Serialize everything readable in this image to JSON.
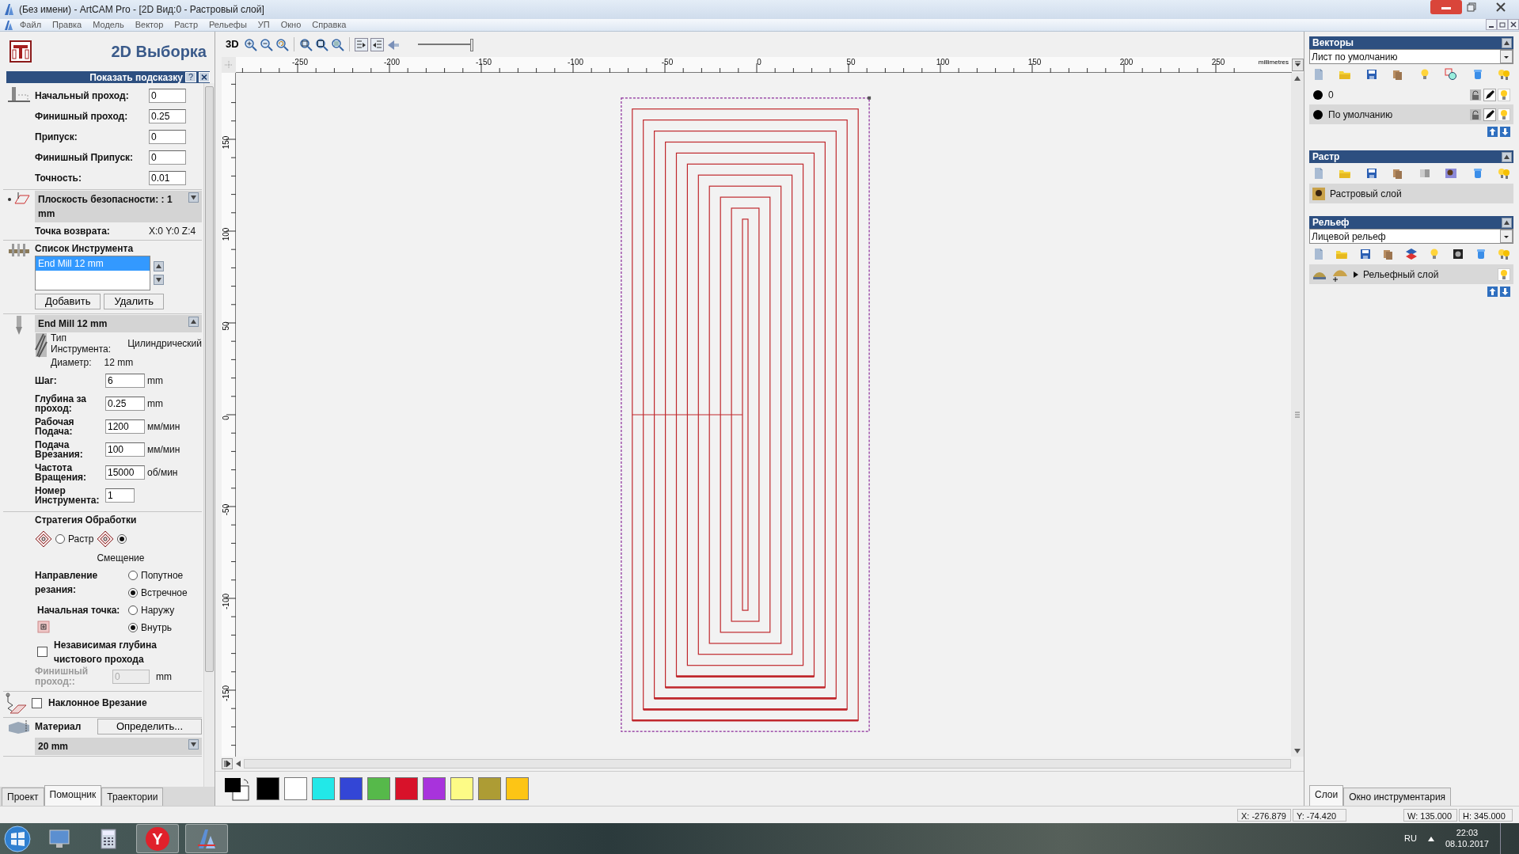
{
  "window": {
    "title": "(Без имени) - ArtCAM Pro - [2D Вид:0 - Растровый слой]"
  },
  "menu": [
    "Файл",
    "Правка",
    "Модель",
    "Вектор",
    "Растр",
    "Рельефы",
    "УП",
    "Окно",
    "Справка"
  ],
  "left_panel": {
    "title": "2D Выборка",
    "hint": "Показать подсказку",
    "help": "?",
    "params": [
      {
        "label": "Начальный проход:",
        "value": "0"
      },
      {
        "label": "Финишный проход:",
        "value": "0.25"
      },
      {
        "label": "Припуск:",
        "value": "0"
      },
      {
        "label": "Финишный Припуск:",
        "value": "0"
      },
      {
        "label": "Точность:",
        "value": "0.01"
      }
    ],
    "safe_z": {
      "label": "Плоскость безопасности: : 1 mm",
      "expanded": false
    },
    "home": {
      "label": "Точка возврата:",
      "value": "X:0 Y:0 Z:4"
    },
    "tool_list": {
      "label": "Список Инструмента",
      "items": [
        {
          "name": "End Mill 12 mm",
          "selected": true
        }
      ],
      "buttons": [
        "Добавить",
        "Удалить"
      ]
    },
    "tool": {
      "name": "End Mill 12 mm",
      "expanded": true,
      "type_label": "Тип Инструмента:",
      "type_value": "Цилиндрический",
      "diameter_label": "Диаметр:",
      "diameter_value": "12 mm"
    },
    "tool_params": [
      {
        "label": "Шаг:",
        "value": "6",
        "unit": "mm"
      },
      {
        "label": "Глубина за проход:",
        "value": "0.25",
        "unit": "mm"
      },
      {
        "label": "Рабочая Подача:",
        "value": "1200",
        "unit": "мм/мин"
      },
      {
        "label": "Подача Врезания:",
        "value": "100",
        "unit": "мм/мин"
      },
      {
        "label": "Частота Вращения:",
        "value": "15000",
        "unit": "об/мин"
      },
      {
        "label": "Номер Инструмента:",
        "value": "1"
      }
    ],
    "strategy": {
      "label": "Стратегия Обработки",
      "options": [
        {
          "label": "Растр",
          "selected": false
        },
        {
          "label": "Смещение",
          "selected": true
        }
      ]
    },
    "direction": {
      "label": "Направление резания:",
      "options": [
        {
          "label": "Попутное",
          "selected": false
        },
        {
          "label": "Встречное",
          "selected": true
        }
      ]
    },
    "start_point": {
      "label": "Начальная точка:",
      "options": [
        {
          "label": "Наружу",
          "selected": false
        },
        {
          "label": "Внутрь",
          "selected": true
        }
      ]
    },
    "independent_depth": {
      "label": "Независимая глубина чистового прохода",
      "checked": false
    },
    "finish_pass": {
      "label": "Финишный проход::",
      "value": "0",
      "unit": "mm",
      "disabled": true
    },
    "ramp": {
      "label": "Наклонное Врезание",
      "checked": false
    },
    "material": {
      "label": "Материал",
      "button": "Определить...",
      "value": "20 mm",
      "expanded": false
    },
    "tabs": [
      {
        "label": "Проект",
        "selected": false
      },
      {
        "label": "Помощник",
        "selected": true
      },
      {
        "label": "Траектории",
        "selected": false
      }
    ]
  },
  "toolbar": {
    "view_3d": "3D",
    "slider": {
      "level": 1
    }
  },
  "ruler": {
    "unit": "millimetres",
    "x_labels": [
      "-250",
      "-200",
      "-150",
      "-100",
      "-50",
      "0",
      "50",
      "100",
      "150",
      "200",
      "250"
    ],
    "y_labels": [
      "150",
      "100",
      "50",
      "0",
      "-50",
      "-100",
      "-150"
    ]
  },
  "palette": {
    "colors": [
      {
        "color": "#000000"
      },
      {
        "color": "#ffffff"
      },
      {
        "color": "#22e8e8"
      },
      {
        "color": "#3346d6"
      },
      {
        "color": "#56b94a"
      },
      {
        "color": "#d8122a"
      },
      {
        "color": "#a833dc"
      },
      {
        "color": "#fdfb86"
      },
      {
        "color": "#ad9c34"
      },
      {
        "color": "#fdc515"
      }
    ]
  },
  "right_panel": {
    "vectors": {
      "title": "Векторы",
      "sheet": "Лист по умолчанию",
      "layers": [
        {
          "name": "0",
          "selected": false
        },
        {
          "name": "По умолчанию",
          "selected": true
        }
      ]
    },
    "raster": {
      "title": "Растр",
      "layers": [
        {
          "name": "Растровый слой",
          "selected": true
        }
      ]
    },
    "relief": {
      "title": "Рельеф",
      "sheet": "Лицевой рельеф",
      "layers": [
        {
          "name": "Рельефный слой",
          "selected": true
        }
      ]
    },
    "tabs": [
      {
        "label": "Слои",
        "selected": true
      },
      {
        "label": "Окно инструментария",
        "selected": false
      }
    ]
  },
  "status_bar": [
    "X: -276.879",
    "Y: -74.420",
    "W: 135.000",
    "H: 345.000"
  ],
  "taskbar": {
    "apps": [
      {
        "kind": "computer"
      },
      {
        "kind": "calculator"
      },
      {
        "kind": "browser",
        "glyph": "Y"
      },
      {
        "kind": "artcam"
      }
    ],
    "language": "RU",
    "time": "22:03",
    "date": "08.10.2017"
  }
}
